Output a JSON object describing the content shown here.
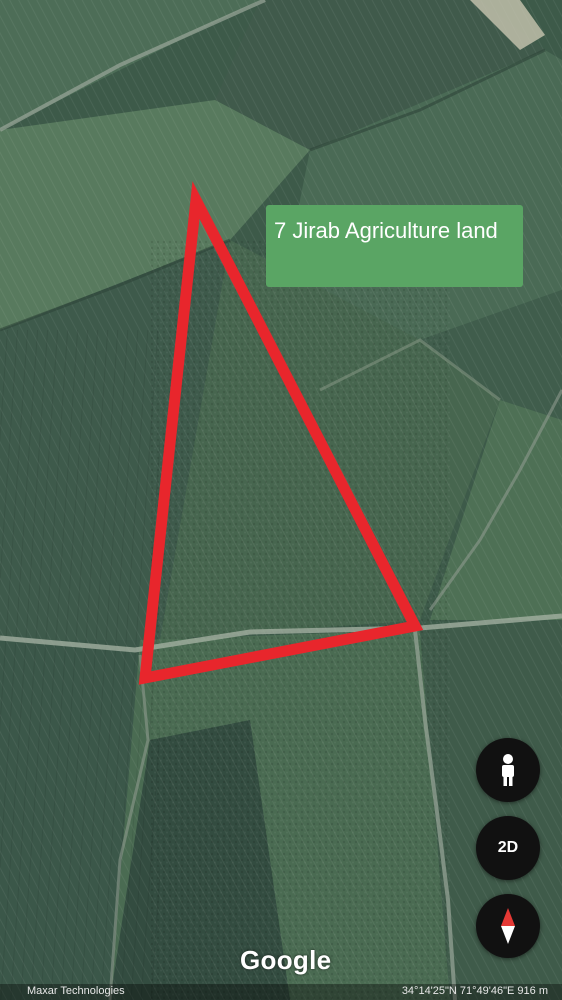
{
  "label": {
    "text": "7 Jirab Agriculture land",
    "bg_color": "#5aa564"
  },
  "boundary": {
    "color": "#e8262c"
  },
  "controls": {
    "street_view_icon": "pegman-icon",
    "view_mode_label": "2D",
    "compass_icon": "compass-icon"
  },
  "footer": {
    "logo_text": "Google",
    "attribution": "Maxar Technologies",
    "coordinates": "34°14'25\"N 71°49'46\"E 916 m"
  }
}
